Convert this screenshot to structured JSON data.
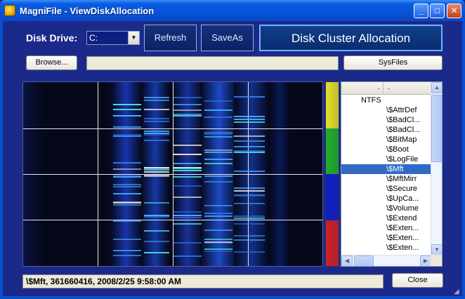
{
  "window": {
    "title": "MagniFile - ViewDiskAllocation",
    "min_glyph": "_",
    "max_glyph": "□",
    "close_glyph": "✕"
  },
  "toolbar": {
    "disk_drive_label": "Disk Drive:",
    "drive_value": "C:",
    "refresh_label": "Refresh",
    "saveas_label": "SaveAs",
    "cluster_label": "Disk Cluster Allocation",
    "browse_label": "Browse...",
    "sysfiles_label": "SysFiles",
    "path_value": ""
  },
  "list": {
    "header_col1": ".",
    "header_col2": ".",
    "rows": [
      {
        "col1": "NTFS",
        "col2": ""
      },
      {
        "col1": "",
        "col2": "\\$AttrDef"
      },
      {
        "col1": "",
        "col2": "\\$BadCl..."
      },
      {
        "col1": "",
        "col2": "\\$BadCl..."
      },
      {
        "col1": "",
        "col2": "\\$BitMap"
      },
      {
        "col1": "",
        "col2": "\\$Boot"
      },
      {
        "col1": "",
        "col2": "\\$LogFile"
      },
      {
        "col1": "",
        "col2": "\\$Mft"
      },
      {
        "col1": "",
        "col2": "\\$MftMirr"
      },
      {
        "col1": "",
        "col2": "\\$Secure"
      },
      {
        "col1": "",
        "col2": "\\$UpCa..."
      },
      {
        "col1": "",
        "col2": "\\$Volume"
      },
      {
        "col1": "",
        "col2": "\\$Extend"
      },
      {
        "col1": "",
        "col2": "\\$Exten..."
      },
      {
        "col1": "",
        "col2": "\\$Exten..."
      },
      {
        "col1": "",
        "col2": "\\$Exten..."
      }
    ],
    "selected_index": 7
  },
  "legend_colors": [
    "#e8e020",
    "#20b020",
    "#1020c0",
    "#d02020"
  ],
  "status_text": "\\$Mft, 361660416, 2008/2/25 9:58:00 AM",
  "close_label": "Close"
}
